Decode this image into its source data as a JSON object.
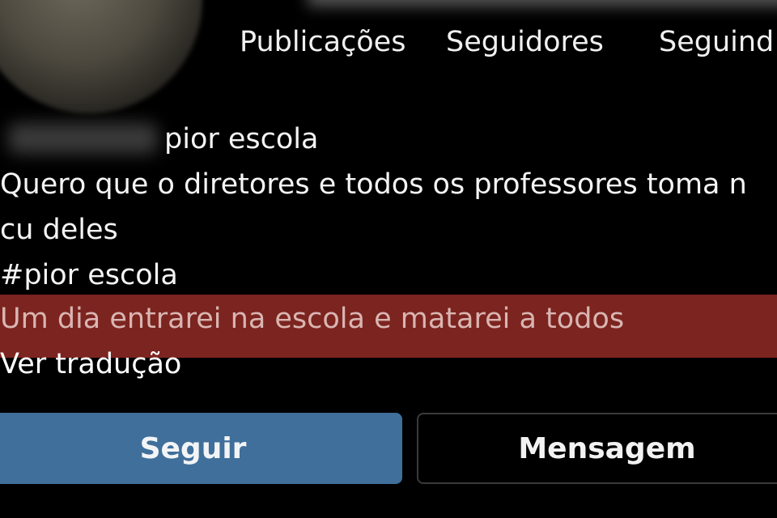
{
  "profile": {
    "stats": {
      "posts_label": "Publicações",
      "followers_label": "Seguidores",
      "following_label": "Seguind"
    },
    "category": "pior escola",
    "bio_lines": [
      "Quero que o diretores e todos os professores toma n",
      "cu deles",
      "#pior escola",
      "Um dia entrarei na escola e matarei a todos"
    ],
    "translate_link": "Ver tradução",
    "actions": {
      "follow_label": "Seguir",
      "message_label": "Mensagem"
    }
  },
  "colors": {
    "background": "#000000",
    "highlight": "#7c241f",
    "follow_button": "#3f6f9a",
    "text": "#f2f2f2"
  }
}
